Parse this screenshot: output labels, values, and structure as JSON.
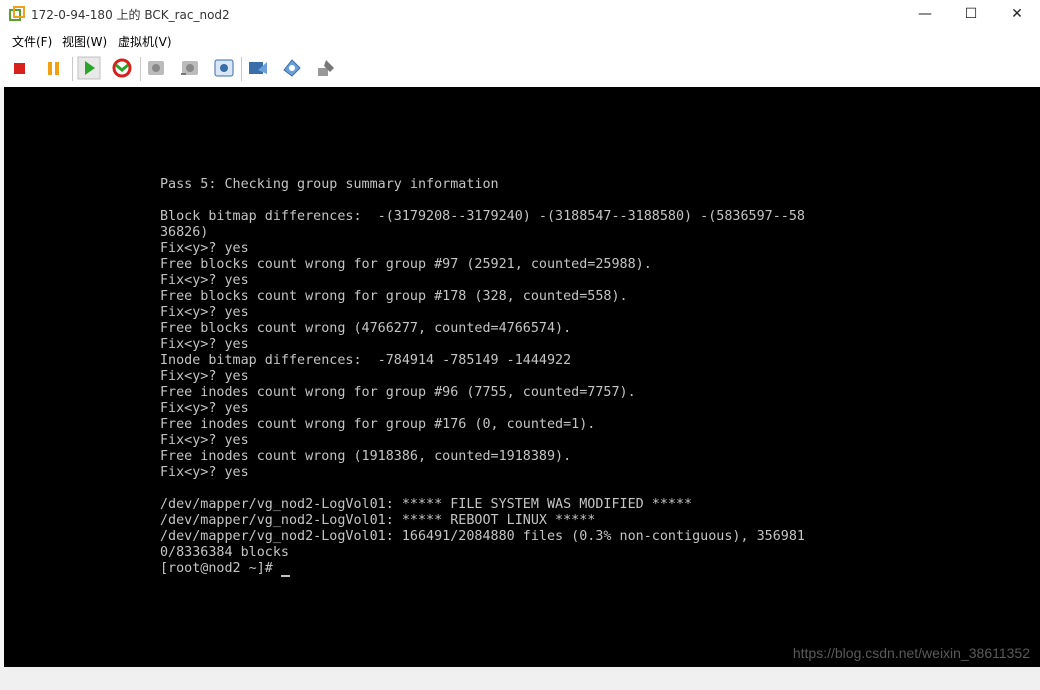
{
  "window": {
    "title": "172-0-94-180 上的 BCK_rac_nod2",
    "minimize": "—",
    "maximize": "☐",
    "close": "✕"
  },
  "menu": [
    {
      "label": "文件(F)"
    },
    {
      "label": "视图(W)"
    },
    {
      "label": "虚拟机(V)"
    }
  ],
  "toolbar": {
    "icons": [
      "stop-icon",
      "pause-icon",
      "play-icon",
      "reset-icon",
      "snapshot-take-icon",
      "snapshot-revert-icon",
      "snapshot-manager-icon",
      "send-keys-icon",
      "vm-settings-icon",
      "tools-icon"
    ]
  },
  "console": {
    "lines": [
      "Pass 5: Checking group summary information",
      "",
      "Block bitmap differences:  -(3179208--3179240) -(3188547--3188580) -(5836597--58",
      "36826)",
      "Fix<y>? yes",
      "Free blocks count wrong for group #97 (25921, counted=25988).",
      "Fix<y>? yes",
      "Free blocks count wrong for group #178 (328, counted=558).",
      "Fix<y>? yes",
      "Free blocks count wrong (4766277, counted=4766574).",
      "Fix<y>? yes",
      "Inode bitmap differences:  -784914 -785149 -1444922",
      "Fix<y>? yes",
      "Free inodes count wrong for group #96 (7755, counted=7757).",
      "Fix<y>? yes",
      "Free inodes count wrong for group #176 (0, counted=1).",
      "Fix<y>? yes",
      "Free inodes count wrong (1918386, counted=1918389).",
      "Fix<y>? yes",
      "",
      "/dev/mapper/vg_nod2-LogVol01: ***** FILE SYSTEM WAS MODIFIED *****",
      "/dev/mapper/vg_nod2-LogVol01: ***** REBOOT LINUX *****",
      "/dev/mapper/vg_nod2-LogVol01: 166491/2084880 files (0.3% non-contiguous), 356981",
      "0/8336384 blocks",
      "[root@nod2 ~]# "
    ]
  },
  "watermark": "https://blog.csdn.net/weixin_38611352",
  "colors": {
    "console_bg": "#000000",
    "console_text": "#c4c4c4"
  }
}
